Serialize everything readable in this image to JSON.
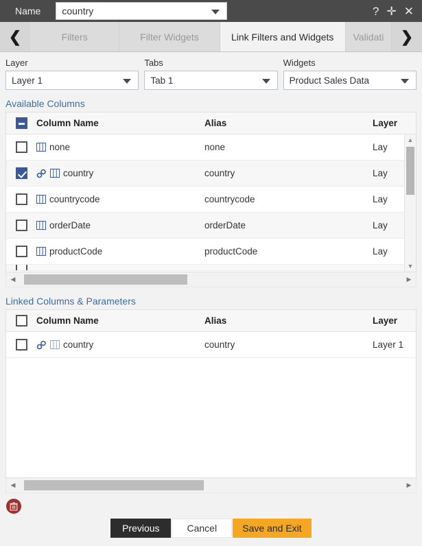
{
  "titlebar": {
    "label": "Name",
    "name_value": "country",
    "help_icon": "?",
    "move_icon": "✛",
    "close_icon": "✕"
  },
  "tabbar": {
    "prev_arrow": "❮",
    "next_arrow": "❯",
    "tabs": [
      {
        "label": "Filters",
        "active": false
      },
      {
        "label": "Filter Widgets",
        "active": false
      },
      {
        "label": "Link Filters and Widgets",
        "active": true
      },
      {
        "label": "Validati",
        "active": false
      }
    ]
  },
  "selectors": [
    {
      "label": "Layer",
      "value": "Layer 1"
    },
    {
      "label": "Tabs",
      "value": "Tab 1"
    },
    {
      "label": "Widgets",
      "value": "Product Sales Data"
    }
  ],
  "available": {
    "title": "Available Columns",
    "header_checkbox": "indeterminate",
    "columns": [
      "Column Name",
      "Alias",
      "Layer"
    ],
    "rows": [
      {
        "checked": false,
        "linked": false,
        "name": "none",
        "alias": "none",
        "layer": "Lay"
      },
      {
        "checked": true,
        "linked": true,
        "name": "country",
        "alias": "country",
        "layer": "Lay"
      },
      {
        "checked": false,
        "linked": false,
        "name": "countrycode",
        "alias": "countrycode",
        "layer": "Lay"
      },
      {
        "checked": false,
        "linked": false,
        "name": "orderDate",
        "alias": "orderDate",
        "layer": "Lay"
      },
      {
        "checked": false,
        "linked": false,
        "name": "productCode",
        "alias": "productCode",
        "layer": "Lay"
      }
    ]
  },
  "linked": {
    "title": "Linked Columns & Parameters",
    "header_checkbox": "unchecked",
    "columns": [
      "Column Name",
      "Alias",
      "Layer"
    ],
    "rows": [
      {
        "checked": false,
        "linked": true,
        "name": "country",
        "alias": "country",
        "layer": "Layer 1"
      }
    ]
  },
  "footer": {
    "delete_icon": "trash-icon",
    "previous_label": "Previous",
    "cancel_label": "Cancel",
    "save_label": "Save and Exit"
  },
  "colors": {
    "titlebar_bg": "#4a4a4a",
    "accent_blue": "#3b5998",
    "section_link": "#3a6ea5",
    "save_orange": "#f5a623",
    "delete_red": "#9b3232"
  }
}
